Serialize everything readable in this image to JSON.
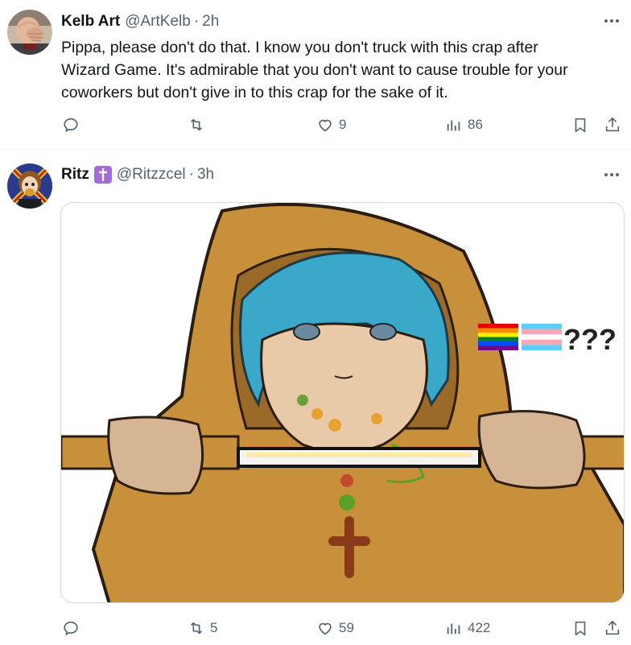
{
  "tweets": [
    {
      "author": {
        "name": "Kelb Art",
        "handle": "@ArtKelb",
        "avatar_icon": "person-facepalm-avatar"
      },
      "time": "2h",
      "text_lines": [
        "Pippa, please don't do that. I know you don't truck with this crap after",
        "Wizard Game. It's admirable that you don't want to cause trouble for your",
        "coworkers but don't give in to this crap for the sake of it."
      ],
      "actions": {
        "reply": "",
        "retweet": "",
        "like": "9",
        "views": "86"
      }
    },
    {
      "author": {
        "name": "Ritz",
        "handle": "@Ritzzcel",
        "badge_icon": "latin-cross-icon",
        "avatar_icon": "cartoon-character-avatar"
      },
      "time": "3h",
      "media": {
        "description_icon": "hooded-girl-with-sword-drawing",
        "overlay_text": "???",
        "flag_icons": [
          "rainbow-flag-icon",
          "transgender-flag-icon"
        ]
      },
      "actions": {
        "reply": "",
        "retweet": "5",
        "like": "59",
        "views": "422"
      }
    }
  ],
  "colors": {
    "text": "#0f1419",
    "secondary": "#536471",
    "border": "#eff3f4",
    "badge": "#a26bd9"
  }
}
